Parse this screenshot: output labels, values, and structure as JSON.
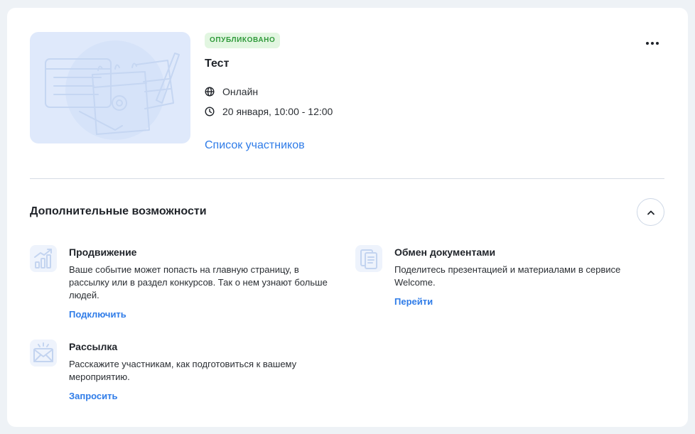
{
  "event": {
    "status": "ОПУБЛИКОВАНО",
    "title": "Тест",
    "location": "Онлайн",
    "datetime": "20 января, 10:00 - 12:00",
    "participants_link": "Список участников"
  },
  "extras": {
    "title": "Дополнительные возможности",
    "features": [
      {
        "title": "Продвижение",
        "description": "Ваше событие может попасть на главную страницу, в рассылку или в раздел конкурсов. Так о нем узнают больше людей.",
        "action": "Подключить",
        "icon": "chart-growth-icon"
      },
      {
        "title": "Рассылка",
        "description": "Расскажите участникам, как подготовиться к вашему мероприятию.",
        "action": "Запросить",
        "icon": "envelope-icon"
      },
      {
        "title": "Обмен документами",
        "description": "Поделитесь презентацией и материалами в сервисе Welcome.",
        "action": "Перейти",
        "icon": "documents-icon"
      }
    ]
  },
  "colors": {
    "accent": "#2f7ce8",
    "status_bg": "#e2f6e1",
    "status_text": "#2f9a3a",
    "cover_bg": "#dfe9fb",
    "icon_tint": "#dde8fb"
  }
}
